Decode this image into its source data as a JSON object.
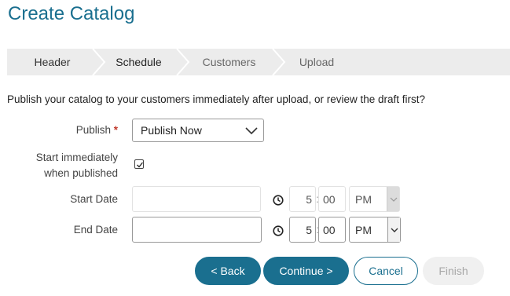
{
  "page": {
    "title": "Create Catalog"
  },
  "steps": [
    {
      "label": "Header",
      "state": "done"
    },
    {
      "label": "Schedule",
      "state": "active"
    },
    {
      "label": "Customers",
      "state": "todo"
    },
    {
      "label": "Upload",
      "state": "todo"
    }
  ],
  "description": "Publish your catalog to your customers immediately after upload, or review the draft first?",
  "publish": {
    "label": "Publish",
    "required_mark": "*",
    "value": "Publish Now"
  },
  "start_immediately": {
    "label_line1": "Start immediately",
    "label_line2": "when published",
    "checked": true
  },
  "start_date": {
    "label": "Start Date",
    "value": "",
    "hour": "5",
    "minute": "00",
    "ampm": "PM",
    "disabled": true
  },
  "end_date": {
    "label": "End Date",
    "value": "",
    "hour": "5",
    "minute": "00",
    "ampm": "PM",
    "disabled": false
  },
  "buttons": {
    "back": "< Back",
    "continue": "Continue >",
    "cancel": "Cancel",
    "finish": "Finish"
  },
  "colors": {
    "primary": "#1a6f8f",
    "required": "#c0392b",
    "steps_bg": "#ececec"
  }
}
